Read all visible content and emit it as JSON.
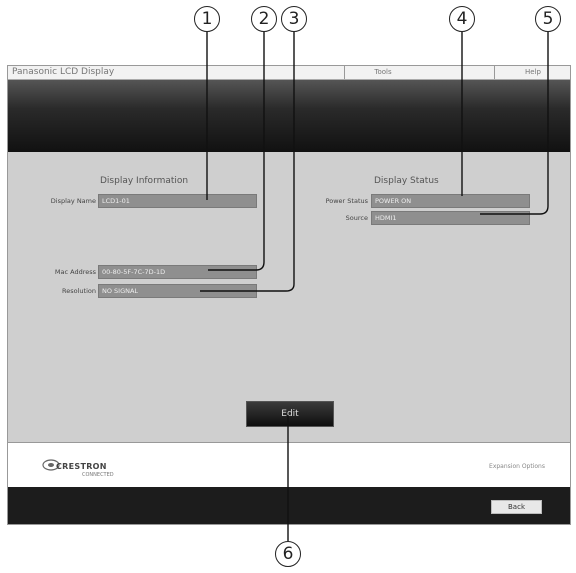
{
  "callouts": [
    "1",
    "2",
    "3",
    "4",
    "5",
    "6"
  ],
  "window": {
    "app_title": "Panasonic LCD Display",
    "menu": [
      "",
      "Tools",
      "",
      "Help"
    ]
  },
  "display_information": {
    "title": "Display Information",
    "display_name_label": "Display Name",
    "display_name_value": "LCD1-01",
    "mac_address_label": "Mac Address",
    "mac_address_value": "00-80-5F-7C-7D-1D",
    "resolution_label": "Resolution",
    "resolution_value": "NO SIGNAL"
  },
  "display_status": {
    "title": "Display Status",
    "power_status_label": "Power Status",
    "power_status_value": "POWER ON",
    "source_label": "Source",
    "source_value": "HDMI1"
  },
  "edit_label": "Edit",
  "footer": {
    "logo_text": "CRESTRON",
    "logo_sub": "CONNECTED",
    "link": "Expansion Options"
  },
  "back_label": "Back",
  "colors": {
    "panel": "#cfcfcf",
    "banner": "#1a1a1a",
    "field": "#8f8f8f"
  }
}
